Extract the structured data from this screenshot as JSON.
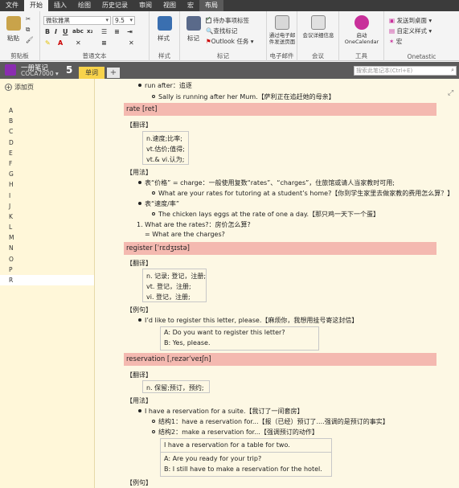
{
  "menu": [
    "文件",
    "开始",
    "插入",
    "绘图",
    "历史记录",
    "审阅",
    "视图",
    "宏",
    "布局"
  ],
  "ribbon": {
    "paste": "粘贴",
    "clipboard": "剪贴板",
    "font_name": "微软雅黑",
    "font_size": "9.5",
    "basic_text": "普通文本",
    "styles": "样式",
    "styles_group": "样式",
    "tag": "标记",
    "todo_tag": "待办事项标签",
    "find_tags": "查找标记",
    "outlook_tasks": "Outlook 任务",
    "tags_group": "标记",
    "email_page": "通过电子邮件发送页面",
    "email_group": "电子邮件",
    "meeting_details": "会议详细信息",
    "meetings_group": "会议",
    "onecalendar": "启动 OneCalendar",
    "tools_group": "工具",
    "send_desktop": "发送到桌面",
    "custom_style": "自定义样式",
    "macro": "宏",
    "onetastic": "Onetastic"
  },
  "notebook": {
    "name": "一册笔记",
    "section": "COCA7000",
    "count": "5",
    "tab": "单词",
    "add_tab": "+",
    "search_placeholder": "搜索此笔记本(Ctrl+E)"
  },
  "pages": {
    "add_page": "添加页",
    "letters": [
      "A",
      "B",
      "C",
      "D",
      "E",
      "F",
      "G",
      "H",
      "I",
      "J",
      "K",
      "L",
      "M",
      "N",
      "O",
      "P",
      "R"
    ]
  },
  "content": {
    "top_bullet": "run after：追逐",
    "top_sub": "Sally is running after her Mum.【萨利正在追赶她的母亲】",
    "w1_header": "rate [ret]",
    "trans_label": "【翻译】",
    "usage_label": "【用法】",
    "example_label": "【例句】",
    "w1_trans": [
      "n.速度;比率;",
      "vt.估价;值得;",
      "vt.& vi.认为;"
    ],
    "w1_use1": "表“价格” = charge：一般使用复数“rates”、“charges”，住旅馆或请人当家教时可用;",
    "w1_use1_sub": "What are your rates for tutoring at a student’s home?【你到学生家里去做家教的费用怎么算？】",
    "w1_use2": "表“速度/率”",
    "w1_use2_sub": "The chicken lays eggs at the rate of one a day.【那只鸡一天下一个蛋】",
    "w1_num1": "1.  What are the rates?：房价怎么算?",
    "w1_num1b": "= What are the charges?",
    "w2_header": "register [ˈrɛdʒɪstə]",
    "w2_trans": [
      "n. 记录; 登记，注册;",
      "vt. 登记，注册;",
      "vi. 登记，注册;"
    ],
    "w2_ex": "I’d like to register this letter, please.【麻烦你，我想用挂号寄这封信】",
    "w2_dialog": [
      "A: Do you want to register this letter?",
      "B: Yes, please."
    ],
    "w3_header": "reservation [ˌrezərˈveɪʃn]",
    "w3_trans": "n. 保留;预订，预约;",
    "w3_use": "I have a reservation for a suite.【我订了一间套房】",
    "w3_s1": "结构1：have a reservation for...【报（已经）预订了....强调的是预订的事实】",
    "w3_s2": "结构2：make a reservation for...【强调预订的动作】",
    "w3_box1": "I have a reservation for a table for two.",
    "w3_box2": [
      "A: Are you ready for your trip?",
      "B: I still have to make a reservation for the hotel."
    ]
  }
}
